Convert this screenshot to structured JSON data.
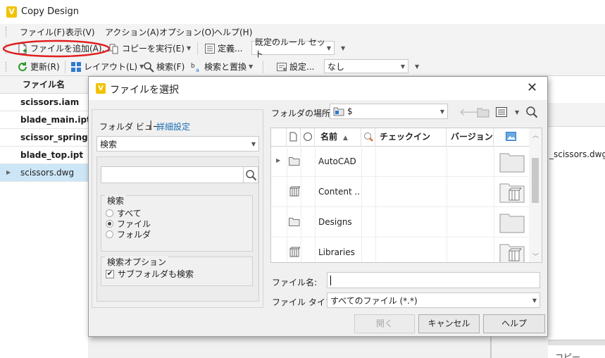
{
  "window": {
    "title": "Copy Design"
  },
  "menu": [
    "ファイル(F)",
    "表示(V)",
    "アクション(A)",
    "オプション(O)",
    "ヘルプ(H)"
  ],
  "toolbar1": {
    "add_files": "ファイルを追加(A)...",
    "run_copy": "コピーを実行(E)",
    "define": "定義...",
    "rule_set": "既定のルール セット"
  },
  "toolbar2": {
    "refresh": "更新(R)",
    "layout": "レイアウト(L)",
    "search": "検索(F)",
    "search_replace": "検索と置換",
    "settings": "設定...",
    "none_select": "なし"
  },
  "filelist": {
    "header": "ファイル名",
    "items": [
      "scissors.iam",
      "blade_main.ipt",
      "scissor_spring.ipt",
      "blade_top.ipt",
      "scissors.dwg"
    ]
  },
  "rightpanel": {
    "item": "_scissors.dwg",
    "bottom_label": "コピー"
  },
  "dialog": {
    "title": "ファイルを選択",
    "folder_view": "フォルダ ビュー",
    "advanced": "詳細設定",
    "search_dropdown": "検索",
    "search_input": "",
    "search_group": "検索",
    "radio_all": "すべて",
    "radio_file": "ファイル",
    "radio_folder": "フォルダ",
    "options_group": "検索オプション",
    "include_subfolders": "サブフォルダも検索",
    "location_label": "フォルダの場所:",
    "location_value": "$",
    "columns": {
      "name": "名前",
      "checkin": "チェックイン",
      "version": "バージョン..."
    },
    "rows": [
      {
        "name": "AutoCAD",
        "icon": "folder-icon"
      },
      {
        "name": "Content ...",
        "icon": "library-icon"
      },
      {
        "name": "Designs",
        "icon": "folder-icon"
      },
      {
        "name": "Libraries",
        "icon": "library-icon"
      }
    ],
    "filename_label": "ファイル名:",
    "filename_value": "",
    "filetype_label": "ファイル タイプ:",
    "filetype_value": "すべてのファイル (*.*)",
    "open_btn": "開く",
    "cancel_btn": "キャンセル",
    "help_btn": "ヘルプ"
  },
  "colors": {
    "highlight_oval": "#e02020",
    "selected_row": "#cde6f7",
    "link": "#1a6fb5",
    "app_icon": "#f2c200"
  }
}
